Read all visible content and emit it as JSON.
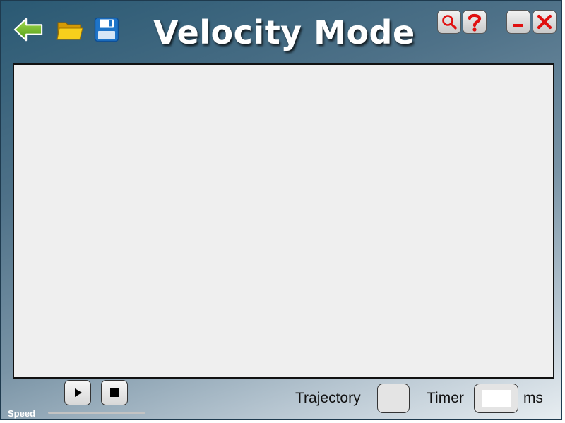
{
  "window": {
    "title": "Velocity Mode"
  },
  "toolbar": {
    "icons": {
      "back": "back-arrow-icon",
      "open": "open-folder-icon",
      "save": "save-disk-icon",
      "search": "search-icon",
      "help": "help-icon",
      "minimize": "minimize-icon",
      "close": "close-icon"
    }
  },
  "controls": {
    "speed_label": "Speed",
    "trajectory_label": "Trajectory",
    "trajectory_value": "",
    "timer_label": "Timer",
    "timer_value": "",
    "timer_unit": "ms"
  },
  "colors": {
    "accent_red": "#e01010",
    "back_green": "#6db31f",
    "folder_yellow": "#f3c413",
    "disk_blue": "#1e74c8",
    "canvas_bg": "#efefef"
  }
}
